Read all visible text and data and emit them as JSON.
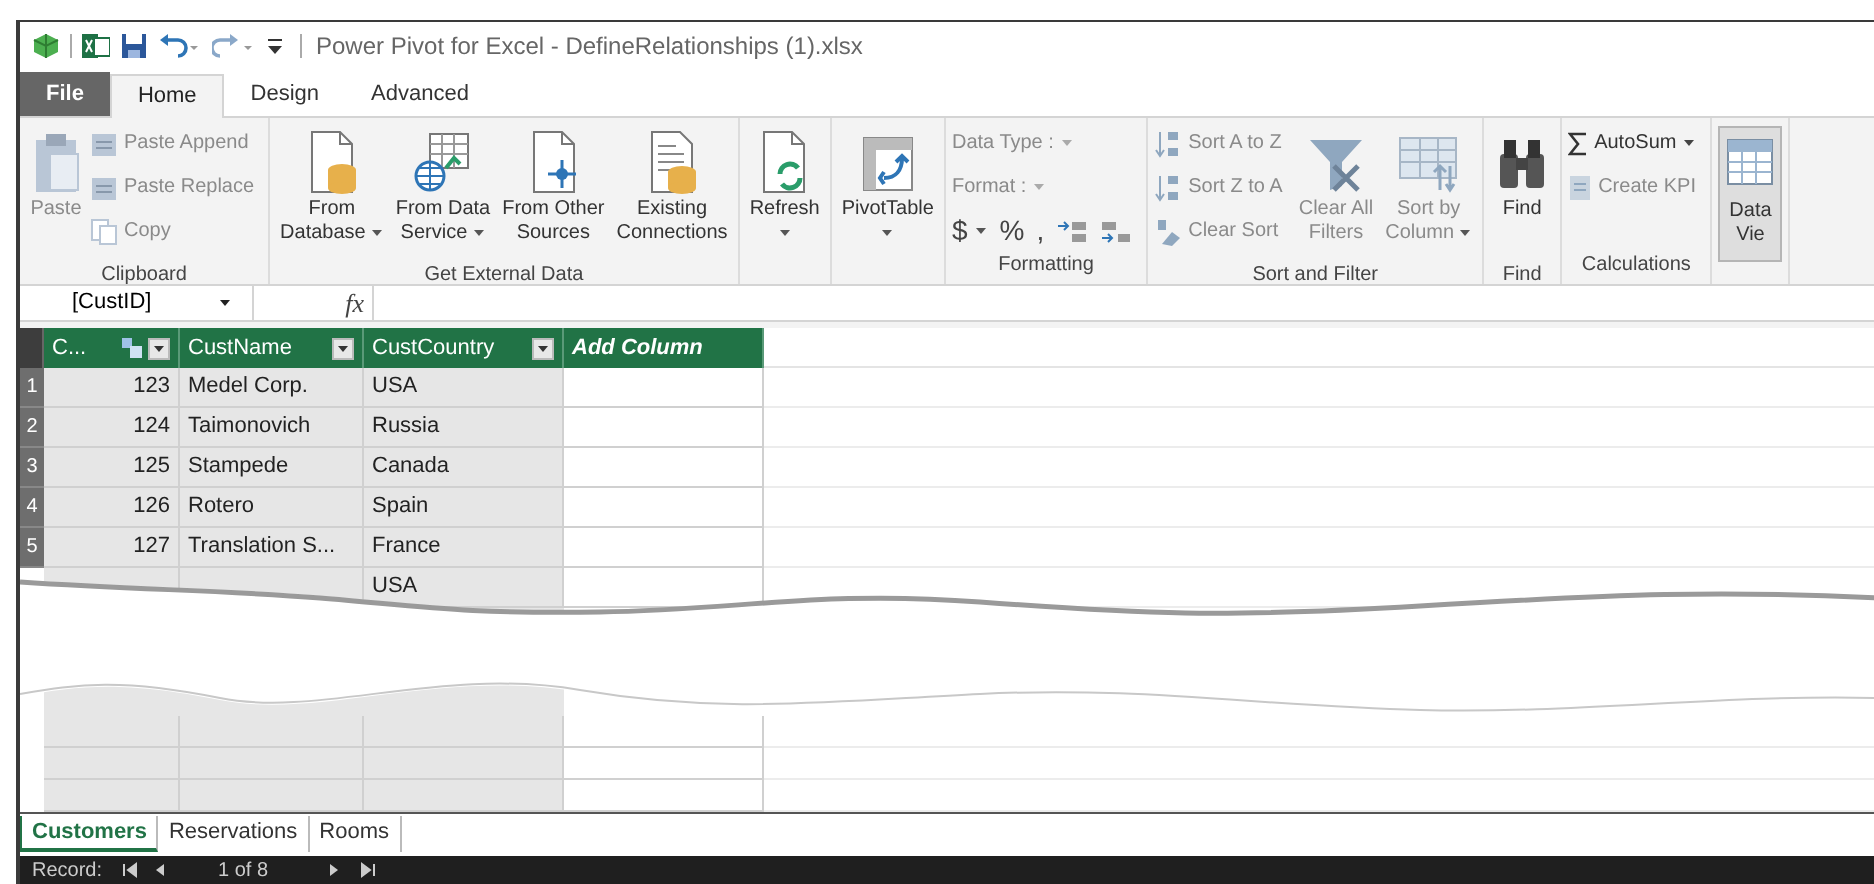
{
  "title_bar": {
    "title": "Power Pivot for Excel - DefineRelationships (1).xlsx"
  },
  "tabs": [
    {
      "label": "File",
      "kind": "file",
      "selected": false
    },
    {
      "label": "Home",
      "kind": "tab",
      "selected": true
    },
    {
      "label": "Design",
      "kind": "tab",
      "selected": false
    },
    {
      "label": "Advanced",
      "kind": "tab",
      "selected": false
    }
  ],
  "ribbon": [
    {
      "label": "Clipboard",
      "buttons": [
        {
          "kind": "large",
          "label": "Paste",
          "disabled": true
        },
        {
          "kind": "small",
          "label": "Paste Append",
          "disabled": true
        },
        {
          "kind": "small",
          "label": "Paste Replace",
          "disabled": true
        },
        {
          "kind": "small",
          "label": "Copy",
          "disabled": true
        }
      ]
    },
    {
      "label": "Get External Data",
      "buttons": [
        {
          "kind": "large",
          "label": "From\nDatabase",
          "dropdown": true,
          "disabled": false
        },
        {
          "kind": "large",
          "label": "From Data\nService",
          "dropdown": true,
          "disabled": false
        },
        {
          "kind": "large",
          "label": "From Other\nSources",
          "disabled": false
        },
        {
          "kind": "large",
          "label": "Existing\nConnections",
          "disabled": false
        }
      ]
    },
    {
      "buttons": [
        {
          "kind": "large",
          "label": "Refresh",
          "dropdown": true,
          "disabled": false
        }
      ]
    },
    {
      "buttons": [
        {
          "kind": "large",
          "label": "PivotTable",
          "dropdown": true,
          "disabled": false
        }
      ]
    },
    {
      "label": "Formatting",
      "buttons": [
        {
          "kind": "small",
          "label": "Data Type :",
          "dropdown": true,
          "disabled": true
        },
        {
          "kind": "small",
          "label": "Format :",
          "dropdown": true,
          "disabled": true
        },
        {
          "kind": "symbols",
          "symbols": [
            "$",
            "%",
            ","
          ]
        }
      ]
    },
    {
      "label": "Sort and Filter",
      "buttons": [
        {
          "kind": "small",
          "label": "Sort A to Z",
          "disabled": true
        },
        {
          "kind": "small",
          "label": "Sort Z to A",
          "disabled": true
        },
        {
          "kind": "small",
          "label": "Clear Sort",
          "disabled": true
        },
        {
          "kind": "large",
          "label": "Clear All\nFilters",
          "disabled": true
        },
        {
          "kind": "large",
          "label": "Sort by\nColumn",
          "dropdown": true,
          "disabled": true
        }
      ]
    },
    {
      "label": "Find",
      "buttons": [
        {
          "kind": "large",
          "label": "Find",
          "disabled": false
        }
      ]
    },
    {
      "label": "Calculations",
      "buttons": [
        {
          "kind": "small",
          "label": "AutoSum",
          "dropdown": true,
          "disabled": false
        },
        {
          "kind": "small",
          "label": "Create KPI",
          "disabled": true
        }
      ]
    },
    {
      "buttons": [
        {
          "kind": "large",
          "label": "Data\nVie",
          "selected": true,
          "disabled": false
        }
      ]
    }
  ],
  "formula_bar": {
    "name_box": "[CustID]",
    "fx": "fx"
  },
  "table": {
    "columns": [
      {
        "label": "C...",
        "kind": "key"
      },
      {
        "label": "CustName",
        "kind": "data"
      },
      {
        "label": "CustCountry",
        "kind": "data"
      },
      {
        "label": "Add Column",
        "kind": "add"
      }
    ],
    "rows": [
      {
        "number": "1",
        "cells": [
          "123",
          "Medel Corp.",
          "USA"
        ]
      },
      {
        "number": "2",
        "cells": [
          "124",
          "Taimonovich",
          "Russia"
        ]
      },
      {
        "number": "3",
        "cells": [
          "125",
          "Stampede",
          "Canada"
        ]
      },
      {
        "number": "4",
        "cells": [
          "126",
          "Rotero",
          "Spain"
        ]
      },
      {
        "number": "5",
        "cells": [
          "127",
          "Translation S...",
          "France"
        ]
      },
      {
        "cells": [
          null,
          null,
          "USA"
        ]
      }
    ]
  },
  "sheet_tabs": [
    {
      "label": "Customers",
      "selected": true
    },
    {
      "label": "Reservations",
      "selected": false
    },
    {
      "label": "Rooms",
      "selected": false
    }
  ],
  "record_bar": {
    "label": "Record:",
    "position": "1 of 8"
  }
}
